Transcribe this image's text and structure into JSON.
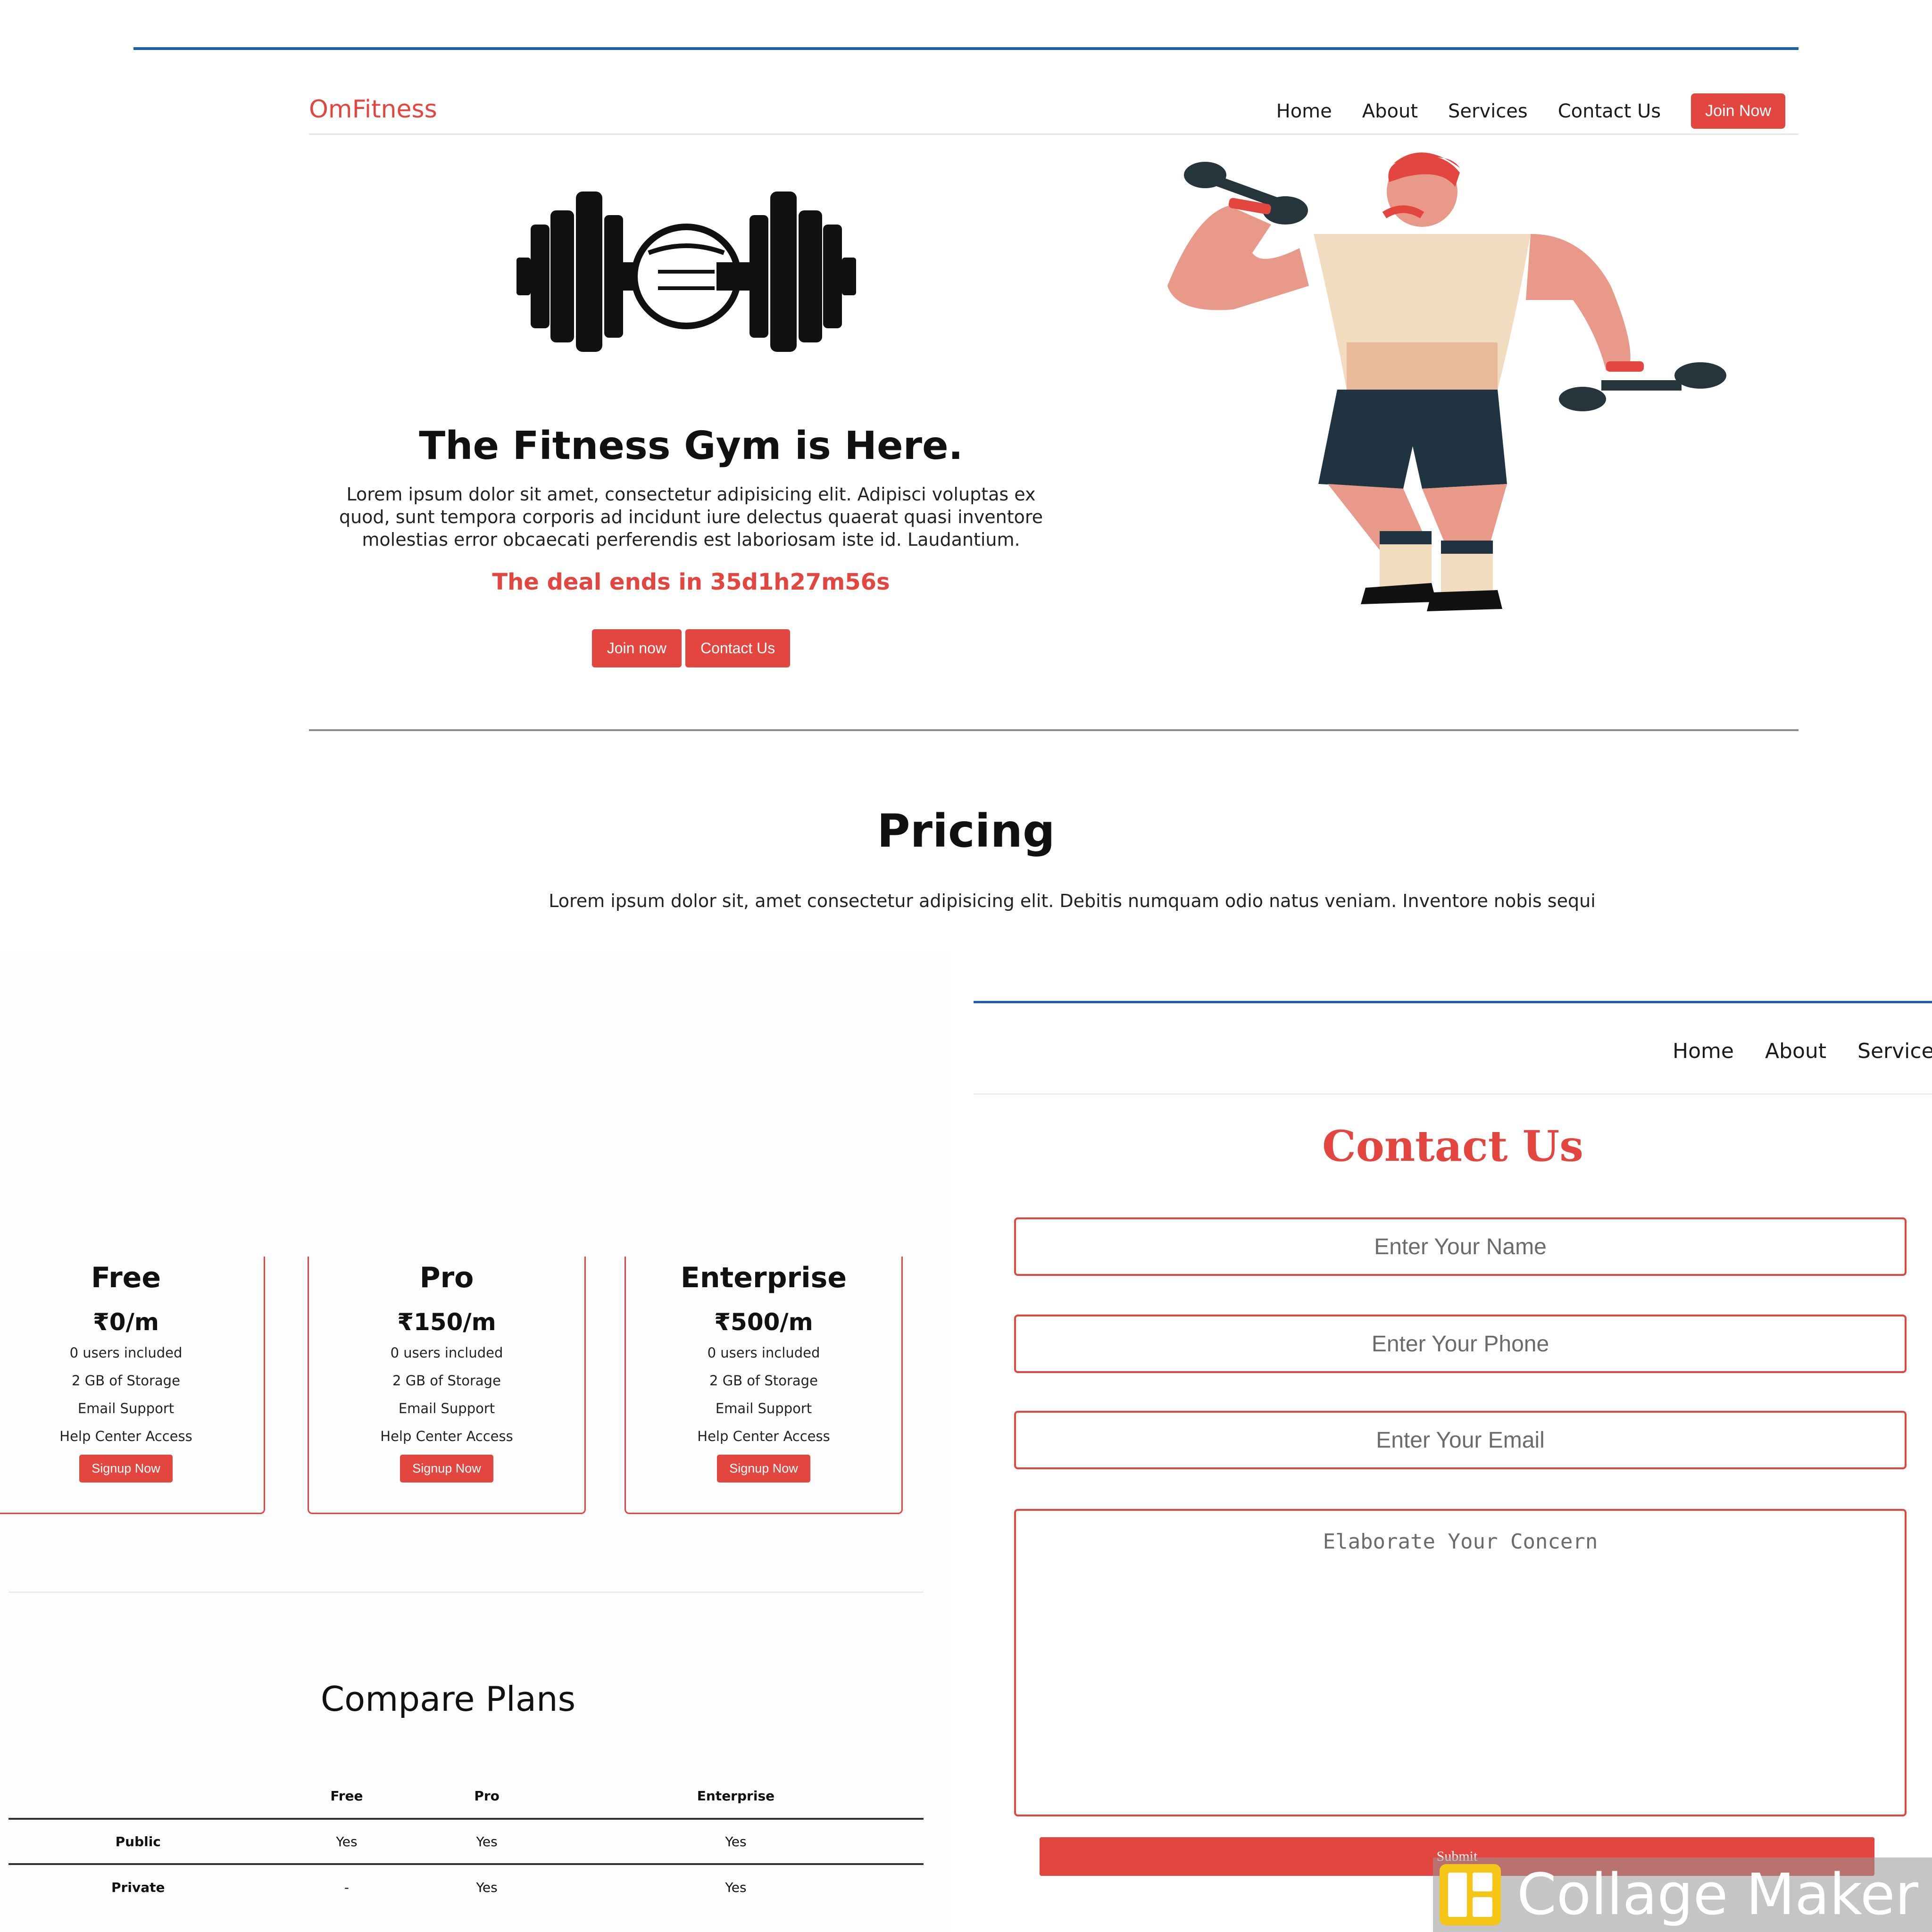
{
  "top_page": {
    "brand": "OmFitness",
    "nav": [
      "Home",
      "About",
      "Services",
      "Contact Us"
    ],
    "join_button": "Join Now",
    "hero": {
      "title": "The Fitness Gym is Here.",
      "text": "Lorem ipsum dolor sit amet, consectetur adipisicing elit. Adipisci voluptas ex quod, sunt tempora corporis ad incidunt iure delectus quaerat quasi inventore molestias error obcaecati perferendis est laboriosam iste id. Laudantium.",
      "deal": "The deal ends in 35d1h27m56s",
      "buttons": [
        "Join now",
        "Contact Us"
      ]
    },
    "pricing": {
      "title": "Pricing",
      "text": "Lorem ipsum dolor sit, amet consectetur adipisicing elit. Debitis numquam odio natus veniam. Inventore nobis sequi"
    }
  },
  "pricing_cards": [
    {
      "name": "Free",
      "price": "₹0/m",
      "features": [
        "0 users included",
        "2 GB of Storage",
        "Email Support",
        "Help Center Access"
      ],
      "button": "Signup Now"
    },
    {
      "name": "Pro",
      "price": "₹150/m",
      "features": [
        "0 users included",
        "2 GB of Storage",
        "Email Support",
        "Help Center Access"
      ],
      "button": "Signup Now"
    },
    {
      "name": "Enterprise",
      "price": "₹500/m",
      "features": [
        "0 users included",
        "2 GB of Storage",
        "Email Support",
        "Help Center Access"
      ],
      "button": "Signup Now"
    }
  ],
  "compare": {
    "title": "Compare Plans",
    "headers": [
      "",
      "Free",
      "Pro",
      "Enterprise"
    ],
    "rows": [
      [
        "Public",
        "Yes",
        "Yes",
        "Yes"
      ],
      [
        "Private",
        "-",
        "Yes",
        "Yes"
      ]
    ]
  },
  "contact_page": {
    "nav": [
      "Home",
      "About",
      "Services"
    ],
    "title": "Contact Us",
    "name_placeholder": "Enter Your Name",
    "phone_placeholder": "Enter Your Phone",
    "email_placeholder": "Enter Your Email",
    "concern_placeholder": "Elaborate Your Concern",
    "submit": "Submit"
  },
  "watermark": {
    "text": "Collage Maker",
    "icon": "collage-maker-logo"
  },
  "colors": {
    "accent": "#e2463e",
    "rule": "#1f5fa8"
  }
}
